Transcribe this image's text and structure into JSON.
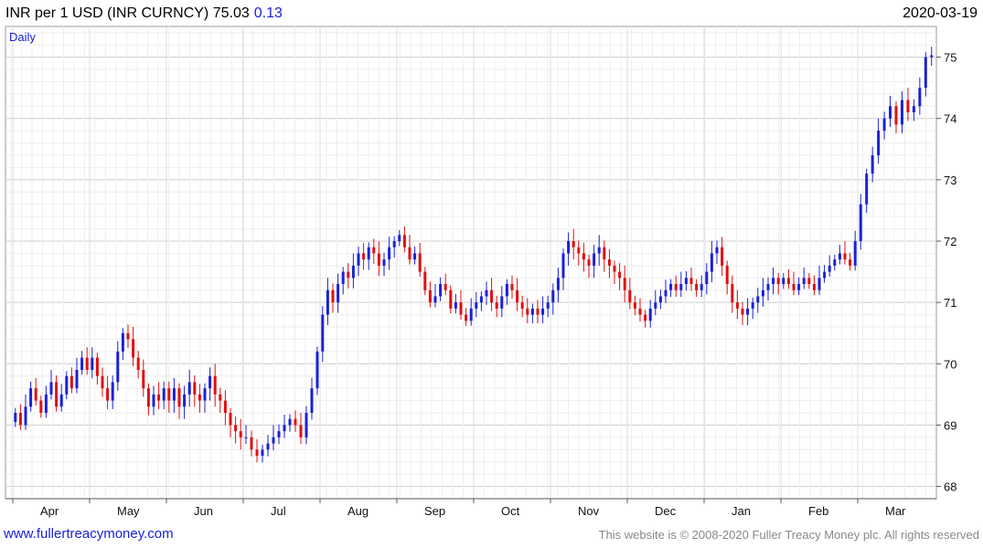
{
  "header": {
    "title": "INR per 1 USD (INR CURNCY)",
    "last_price": "75.03",
    "change": "0.13",
    "date": "2020-03-19",
    "frequency": "Daily"
  },
  "footer": {
    "site_link": "www.fullertreacymoney.com",
    "copyright": "This website is © 2008-2020 Fuller Treacy Money plc. All rights reserved"
  },
  "colors": {
    "up": "#1a22d6",
    "down": "#e01010",
    "grid": "#d9d9d9"
  },
  "chart_data": {
    "type": "candlestick",
    "ylim": [
      67.8,
      75.5
    ],
    "y_ticks": [
      68,
      69,
      70,
      71,
      72,
      73,
      74,
      75
    ],
    "x_labels": [
      "Apr",
      "May",
      "Jun",
      "Jul",
      "Aug",
      "Sep",
      "Oct",
      "Nov",
      "Dec",
      "Jan",
      "Feb",
      "Mar"
    ],
    "grid": true,
    "series_approx_close": [
      {
        "month": "Apr",
        "values": [
          69.2,
          69.0,
          69.3,
          69.6,
          69.4,
          69.2,
          69.5,
          69.7,
          69.3,
          69.5,
          69.8,
          69.6,
          69.9,
          70.1,
          69.9
        ]
      },
      {
        "month": "May",
        "values": [
          70.1,
          69.8,
          69.6,
          69.4,
          69.7,
          70.2,
          70.5,
          70.4,
          70.1,
          69.9,
          69.6,
          69.3,
          69.5,
          69.4,
          69.6
        ]
      },
      {
        "month": "Jun",
        "values": [
          69.4,
          69.6,
          69.3,
          69.5,
          69.7,
          69.5,
          69.4,
          69.6,
          69.8,
          69.5,
          69.4,
          69.2,
          69.0,
          68.9,
          68.8
        ]
      },
      {
        "month": "Jul",
        "values": [
          68.8,
          68.6,
          68.5,
          68.6,
          68.7,
          68.8,
          68.9,
          69.0,
          69.1,
          69.0,
          68.8,
          69.2,
          69.6,
          70.2
        ]
      },
      {
        "month": "Aug",
        "values": [
          70.8,
          71.2,
          71.0,
          71.3,
          71.5,
          71.4,
          71.6,
          71.8,
          71.7,
          71.9,
          71.8,
          71.6,
          71.7,
          71.9,
          72.0
        ]
      },
      {
        "month": "Sep",
        "values": [
          72.1,
          71.9,
          71.7,
          71.8,
          71.5,
          71.2,
          71.0,
          71.1,
          71.3,
          71.2,
          70.9,
          71.0,
          70.8,
          70.7,
          70.9
        ]
      },
      {
        "month": "Oct",
        "values": [
          71.0,
          71.1,
          71.2,
          71.0,
          70.9,
          71.1,
          71.3,
          71.2,
          71.0,
          70.9,
          70.8,
          70.9,
          70.8,
          70.9,
          71.0
        ]
      },
      {
        "month": "Nov",
        "values": [
          71.2,
          71.4,
          71.8,
          72.0,
          71.9,
          71.8,
          71.7,
          71.6,
          71.8,
          71.9,
          71.7,
          71.6,
          71.5,
          71.4,
          71.2
        ]
      },
      {
        "month": "Dec",
        "values": [
          71.0,
          70.9,
          70.8,
          70.7,
          70.9,
          71.0,
          71.1,
          71.2,
          71.3,
          71.2,
          71.3,
          71.4,
          71.3,
          71.2,
          71.3
        ]
      },
      {
        "month": "Jan",
        "values": [
          71.5,
          71.8,
          71.9,
          71.6,
          71.3,
          71.0,
          70.9,
          70.8,
          70.9,
          71.0,
          71.1,
          71.2,
          71.3,
          71.4,
          71.3
        ]
      },
      {
        "month": "Feb",
        "values": [
          71.4,
          71.3,
          71.2,
          71.3,
          71.4,
          71.3,
          71.2,
          71.4,
          71.5,
          71.6,
          71.7,
          71.8,
          71.7,
          71.6,
          72.0
        ]
      },
      {
        "month": "Mar",
        "values": [
          72.6,
          73.1,
          73.4,
          73.8,
          74.0,
          74.2,
          73.9,
          74.3,
          74.1,
          74.2,
          74.5,
          75.0,
          75.03
        ]
      }
    ]
  }
}
